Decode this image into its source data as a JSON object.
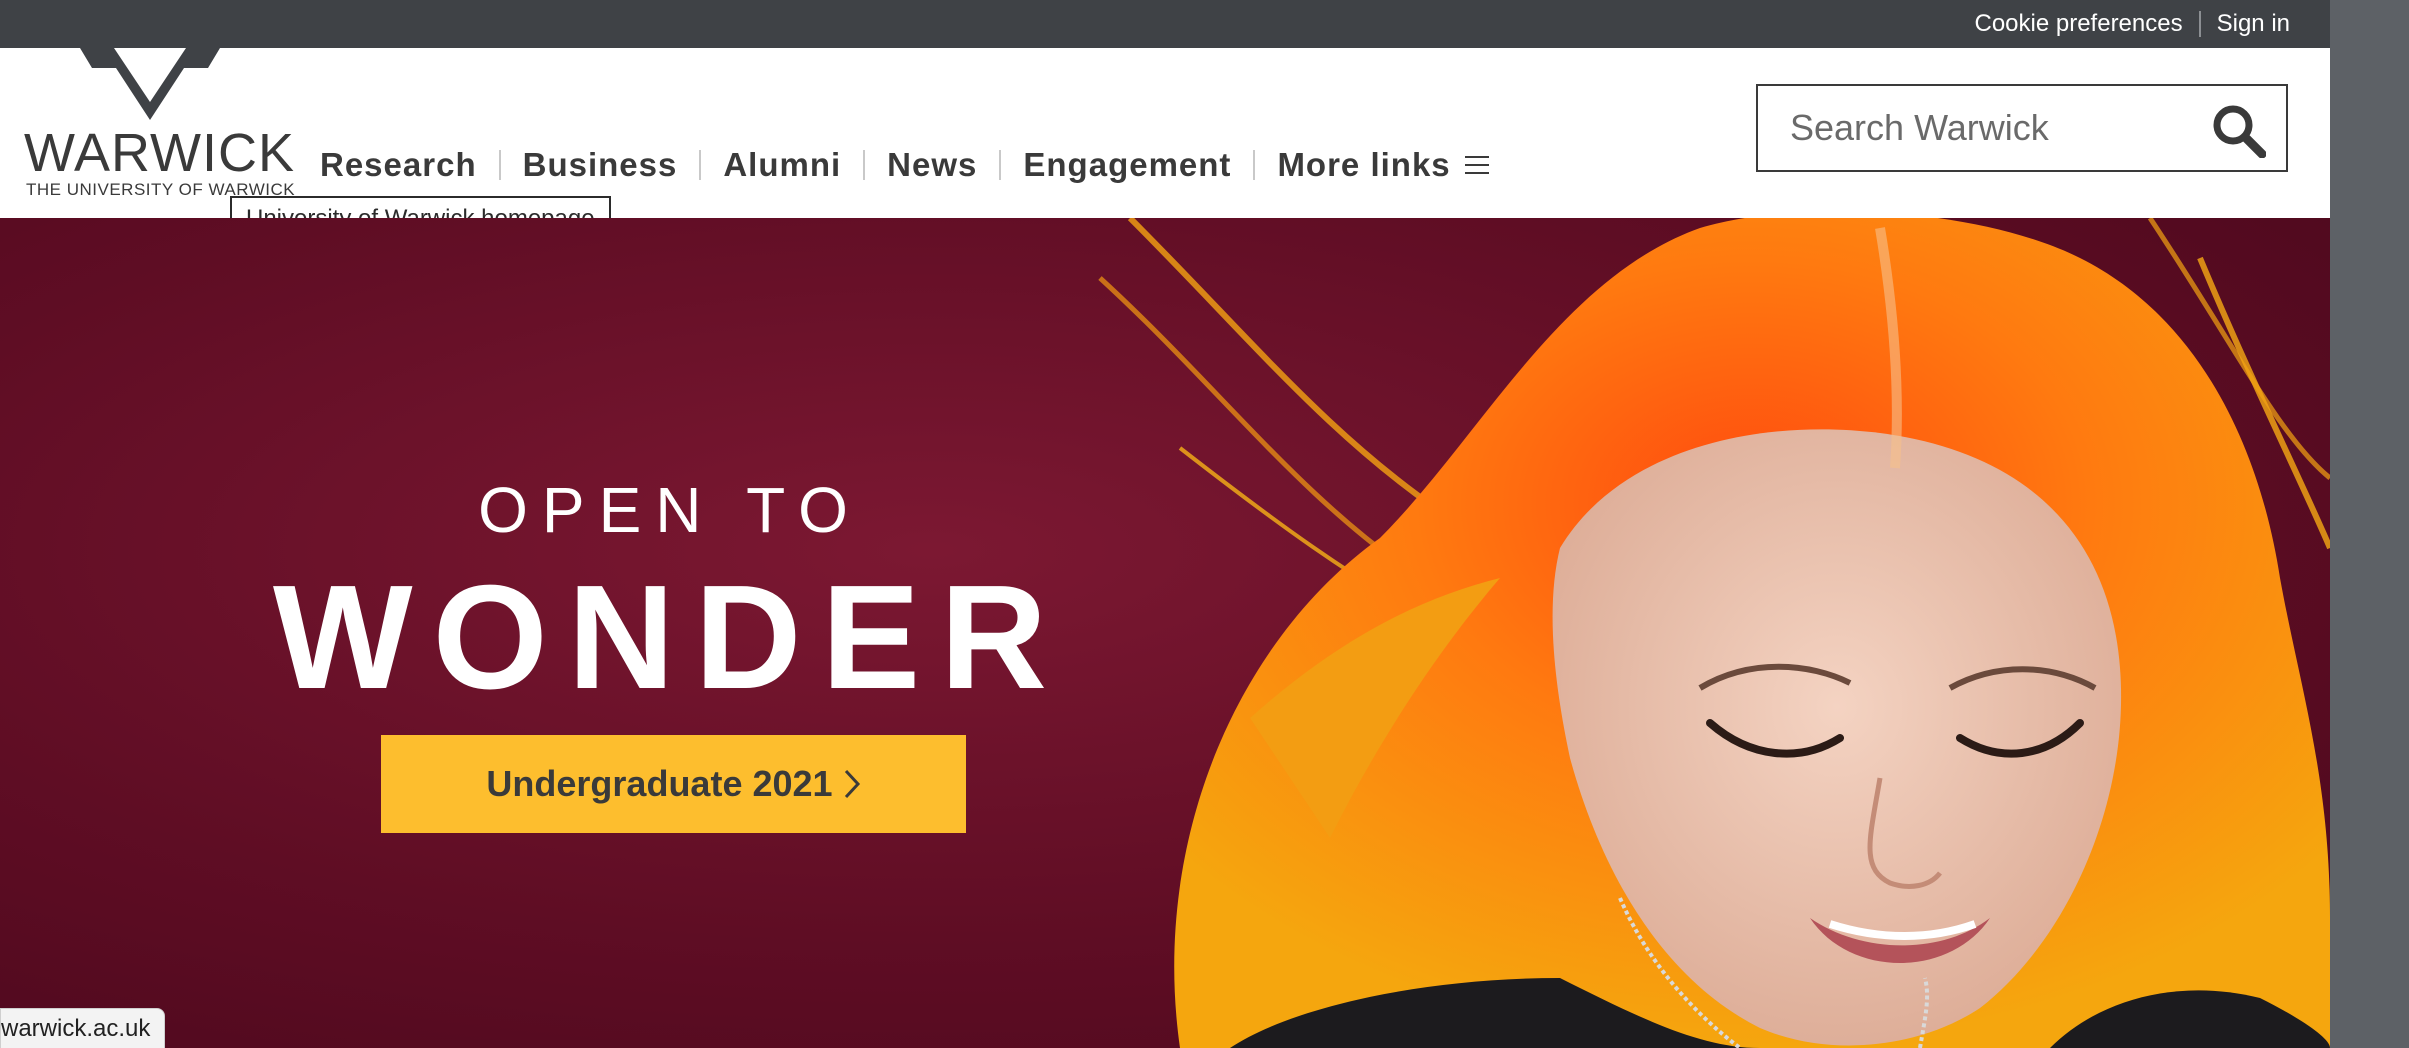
{
  "utility": {
    "cookie_label": "Cookie preferences",
    "signin_label": "Sign in"
  },
  "logo": {
    "wordmark": "WARWICK",
    "subtitle": "THE UNIVERSITY OF WARWICK"
  },
  "tooltip": {
    "text": "University of Warwick homepage"
  },
  "nav": {
    "items": [
      {
        "label": "Research"
      },
      {
        "label": "Business"
      },
      {
        "label": "Alumni"
      },
      {
        "label": "News"
      },
      {
        "label": "Engagement"
      },
      {
        "label": "More links"
      }
    ]
  },
  "search": {
    "placeholder": "Search Warwick",
    "icon": "search-icon"
  },
  "hero": {
    "kicker": "OPEN TO",
    "title": "WONDER",
    "cta_label": "Undergraduate 2021"
  },
  "status": {
    "url": "warwick.ac.uk"
  },
  "colors": {
    "utility_bar": "#3f4246",
    "hero_bg": "#5f0d24",
    "cta": "#fdbe2e",
    "text_dark": "#3a3a3a"
  }
}
